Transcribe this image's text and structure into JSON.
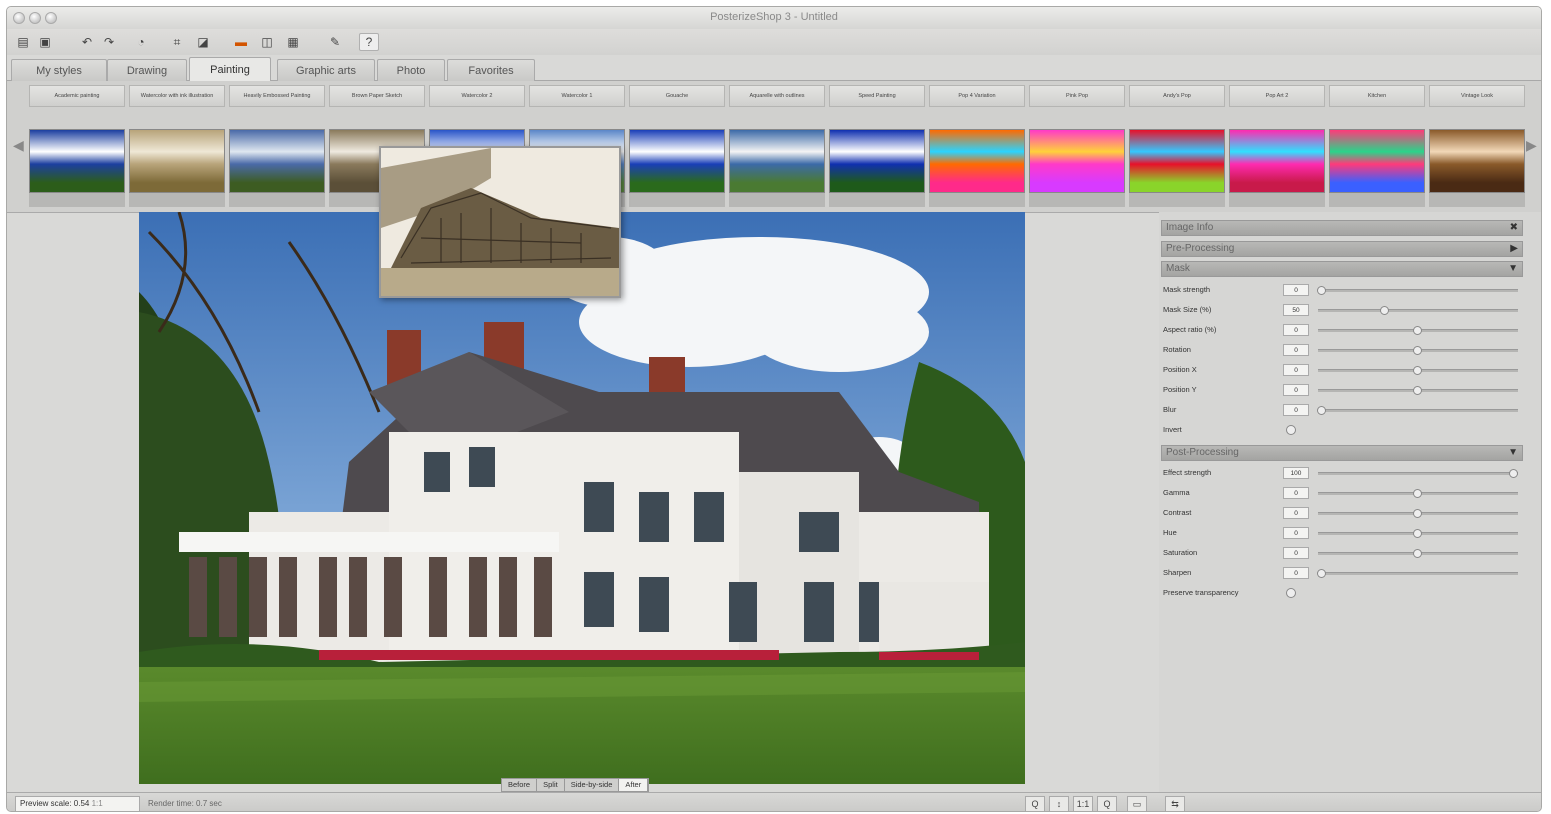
{
  "window": {
    "title": "PosterizeShop 3 - Untitled"
  },
  "toolbar": {
    "icons": [
      "open-icon",
      "save-icon",
      "undo-icon",
      "redo-icon",
      "zoom-icon",
      "crop-icon",
      "lock-icon",
      "layout-single-icon",
      "layout-split-icon",
      "layout-grid-icon",
      "brush-icon",
      "help-icon"
    ],
    "help_label": "?"
  },
  "tabs": [
    {
      "label": "My styles"
    },
    {
      "label": "Drawing"
    },
    {
      "label": "Painting"
    },
    {
      "label": "Graphic arts"
    },
    {
      "label": "Photo"
    },
    {
      "label": "Favorites"
    }
  ],
  "styles": [
    {
      "label": "Academic painting",
      "colors": [
        "#1c3fa0",
        "#ffffff",
        "#2c5d1a"
      ]
    },
    {
      "label": "Watercolor with ink illustration",
      "colors": [
        "#b8a47a",
        "#efe8d6",
        "#7d6a38"
      ]
    },
    {
      "label": "Heavily Embossed Painting",
      "colors": [
        "#4a6aa8",
        "#dfe7f0",
        "#3d5c22"
      ]
    },
    {
      "label": "Brown Paper Sketch",
      "colors": [
        "#8a7a5c",
        "#efeae0",
        "#5b4f38"
      ]
    },
    {
      "label": "Watercolor 2",
      "colors": [
        "#2a55c8",
        "#e9f0ff",
        "#3a6b2a"
      ]
    },
    {
      "label": "Watercolor 1",
      "colors": [
        "#5a86c8",
        "#ffffff",
        "#5c8a42"
      ]
    },
    {
      "label": "Gouache",
      "colors": [
        "#1a3fb8",
        "#ffffff",
        "#2a6a1c"
      ]
    },
    {
      "label": "Aquarelle with outlines",
      "colors": [
        "#3c6aa8",
        "#f4f4f4",
        "#4a7a32"
      ]
    },
    {
      "label": "Speed Painting",
      "colors": [
        "#1030b0",
        "#ffffff",
        "#1e5a1a"
      ]
    },
    {
      "label": "Pop 4 Variation",
      "colors": [
        "#ff6a00",
        "#2ad4ff",
        "#ff2a8a"
      ]
    },
    {
      "label": "Pink Pop",
      "colors": [
        "#ff3ac8",
        "#ffd23a",
        "#d83aff"
      ]
    },
    {
      "label": "Andy's Pop",
      "colors": [
        "#e8102a",
        "#34c8ff",
        "#8ad42a"
      ]
    },
    {
      "label": "Pop Art 2",
      "colors": [
        "#ff2ab0",
        "#30e0ff",
        "#c81a4a"
      ]
    },
    {
      "label": "Kitchen",
      "colors": [
        "#ff3a7a",
        "#2ad48a",
        "#3a60ff"
      ]
    },
    {
      "label": "Vintage Look",
      "colors": [
        "#8a5a2a",
        "#f2d8b8",
        "#4a2a14"
      ]
    }
  ],
  "panel": {
    "sections": {
      "image_info": "Image Info",
      "pre_processing": "Pre-Processing",
      "mask": "Mask",
      "post_processing": "Post-Processing"
    },
    "mask_rows": [
      {
        "label": "Mask strength",
        "value": "0",
        "level": 0.0
      },
      {
        "label": "Mask Size (%)",
        "value": "50",
        "level": 0.33
      },
      {
        "label": "Aspect ratio (%)",
        "value": "0",
        "level": 0.5
      },
      {
        "label": "Rotation",
        "value": "0",
        "level": 0.5
      },
      {
        "label": "Position X",
        "value": "0",
        "level": 0.5
      },
      {
        "label": "Position Y",
        "value": "0",
        "level": 0.5
      },
      {
        "label": "Blur",
        "value": "0",
        "level": 0.0
      }
    ],
    "invert_label": "Invert",
    "post_rows": [
      {
        "label": "Effect strength",
        "value": "100",
        "level": 1.0
      },
      {
        "label": "Gamma",
        "value": "0",
        "level": 0.5
      },
      {
        "label": "Contrast",
        "value": "0",
        "level": 0.5
      },
      {
        "label": "Hue",
        "value": "0",
        "level": 0.5
      },
      {
        "label": "Saturation",
        "value": "0",
        "level": 0.5
      },
      {
        "label": "Sharpen",
        "value": "0",
        "level": 0.0
      }
    ],
    "preserve_label": "Preserve transparency"
  },
  "view_modes": [
    {
      "label": "Before"
    },
    {
      "label": "Split"
    },
    {
      "label": "Side-by-side"
    },
    {
      "label": "After"
    }
  ],
  "status": {
    "preview_scale": "Preview scale: 0.54",
    "scale_suffix": "1:1",
    "render_time": "Render time: 0.7 sec",
    "zoom_labels": [
      "Q",
      "↕",
      "1:1",
      "Q"
    ]
  }
}
